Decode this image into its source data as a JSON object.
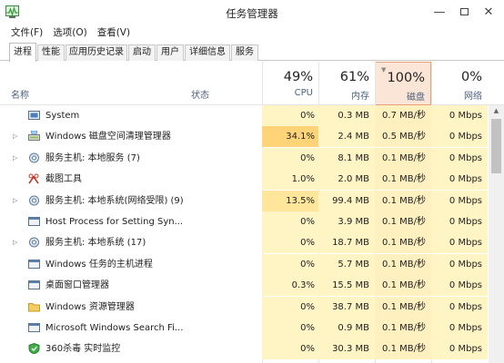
{
  "window": {
    "title": "任务管理器"
  },
  "menu": [
    "文件(F)",
    "选项(O)",
    "查看(V)"
  ],
  "tabs": [
    "进程",
    "性能",
    "应用历史记录",
    "启动",
    "用户",
    "详细信息",
    "服务"
  ],
  "header": {
    "name": "名称",
    "status": "状态",
    "cpu": {
      "pct": "49%",
      "label": "CPU"
    },
    "mem": {
      "pct": "61%",
      "label": "内存"
    },
    "disk": {
      "pct": "100%",
      "label": "磁盘"
    },
    "net": {
      "pct": "0%",
      "label": "网络"
    }
  },
  "rows": [
    {
      "name": "System",
      "cpu": "0%",
      "mem": "0.3 MB",
      "disk": "0.7 MB/秒",
      "net": "0 Mbps",
      "icon": "system-icon",
      "expand": false
    },
    {
      "name": "Windows 磁盘空间清理管理器",
      "cpu": "34.1%",
      "mem": "2.4 MB",
      "disk": "0.5 MB/秒",
      "net": "0 Mbps",
      "icon": "disk-cleanup-icon",
      "expand": true
    },
    {
      "name": "服务主机: 本地服务 (7)",
      "cpu": "0%",
      "mem": "8.1 MB",
      "disk": "0.1 MB/秒",
      "net": "0 Mbps",
      "icon": "gear-icon",
      "expand": true
    },
    {
      "name": "截图工具",
      "cpu": "1.0%",
      "mem": "2.0 MB",
      "disk": "0.1 MB/秒",
      "net": "0 Mbps",
      "icon": "snipping-tool-icon",
      "expand": false
    },
    {
      "name": "服务主机: 本地系统(网络受限) (9)",
      "cpu": "13.5%",
      "mem": "99.4 MB",
      "disk": "0.1 MB/秒",
      "net": "0 Mbps",
      "icon": "gear-icon",
      "expand": true
    },
    {
      "name": "Host Process for Setting Syn...",
      "cpu": "0%",
      "mem": "3.9 MB",
      "disk": "0.1 MB/秒",
      "net": "0 Mbps",
      "icon": "window-icon",
      "expand": false
    },
    {
      "name": "服务主机: 本地系统 (17)",
      "cpu": "0%",
      "mem": "18.7 MB",
      "disk": "0.1 MB/秒",
      "net": "0 Mbps",
      "icon": "gear-icon",
      "expand": true
    },
    {
      "name": "Windows 任务的主机进程",
      "cpu": "0%",
      "mem": "5.7 MB",
      "disk": "0.1 MB/秒",
      "net": "0 Mbps",
      "icon": "window-icon",
      "expand": false
    },
    {
      "name": "桌面窗口管理器",
      "cpu": "0.3%",
      "mem": "15.5 MB",
      "disk": "0.1 MB/秒",
      "net": "0 Mbps",
      "icon": "window-icon",
      "expand": false
    },
    {
      "name": "Windows 资源管理器",
      "cpu": "0%",
      "mem": "38.7 MB",
      "disk": "0.1 MB/秒",
      "net": "0 Mbps",
      "icon": "folder-icon",
      "expand": false
    },
    {
      "name": "Microsoft Windows Search Fi...",
      "cpu": "0%",
      "mem": "0.9 MB",
      "disk": "0.1 MB/秒",
      "net": "0 Mbps",
      "icon": "window-icon",
      "expand": false
    },
    {
      "name": "360杀毒 实时监控",
      "cpu": "0%",
      "mem": "30.3 MB",
      "disk": "0.1 MB/秒",
      "net": "0 Mbps",
      "icon": "shield-icon",
      "expand": false
    }
  ]
}
